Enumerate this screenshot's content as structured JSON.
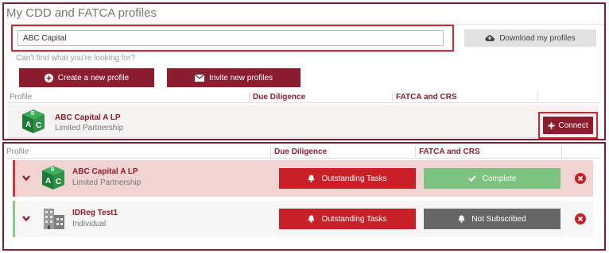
{
  "page": {
    "title": "My CDD and FATCA profiles"
  },
  "search": {
    "value": "ABC Capital",
    "hint": "Can't find what you're looking for?"
  },
  "buttons": {
    "download": "Download my profiles",
    "create": "Create a new profile",
    "invite": "Invite new profiles",
    "connect": "Connect"
  },
  "columns": {
    "profile": "Profile",
    "due_diligence": "Due Diligence",
    "fatca": "FATCA and CRS"
  },
  "search_result": {
    "name": "ABC Capital A LP",
    "type": "Limited Partnership"
  },
  "profiles": [
    {
      "name": "ABC Capital A LP",
      "type": "Limited Partnership",
      "due_diligence": "Outstanding Tasks",
      "fatca": "Complete"
    },
    {
      "name": "IDReg Test1",
      "type": "Individual",
      "due_diligence": "Outstanding Tasks",
      "fatca": "Not Subscribed"
    }
  ],
  "colors": {
    "brand": "#8b1d2e",
    "danger": "#c72127",
    "success": "#7dc380",
    "neutral": "#666666",
    "highlight": "#d6262f"
  },
  "icons": {
    "download": "cloud-icon",
    "create": "plus-circle-icon",
    "invite": "envelope-icon",
    "connect": "plus-icon",
    "expand": "chevron-down-icon",
    "tasks": "bell-icon",
    "complete": "check-icon",
    "remove": "close-circle-icon",
    "abc_logo": "abc-blocks-logo",
    "building_logo": "building-icon"
  }
}
